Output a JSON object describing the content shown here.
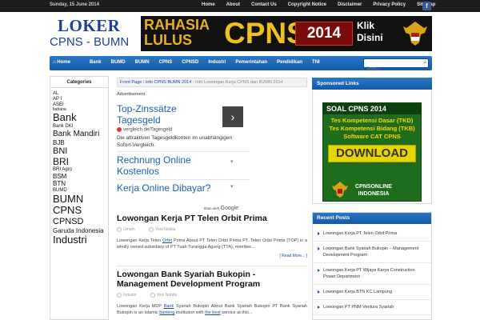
{
  "topbar": {
    "date": "Sunday, 15 June 2014",
    "links": [
      "Home",
      "About",
      "Contact Us",
      "Copyright Notice",
      "Disclaimer",
      "Privacy Policy",
      "Sitemap"
    ],
    "social_icon": "facebook-icon"
  },
  "logo": {
    "line1": "LOKER",
    "line2": "CPNS - BUMN"
  },
  "banner": {
    "line1": "RAHASIA",
    "line2": "LULUS",
    "big": "CPNS",
    "year": "2014",
    "cta_line1": "Klik",
    "cta_line2": "Disini",
    "emblem": "garuda-emblem"
  },
  "nav": {
    "items": [
      "Home",
      "Bank",
      "BUMD",
      "BUMN",
      "CPNS",
      "CPNSD",
      "Industri",
      "Pemerintahan",
      "Pendidikan",
      "TNI"
    ],
    "search_placeholder": "Search..."
  },
  "categories": {
    "title": "Categories",
    "items": [
      {
        "label": "AL",
        "size": 6
      },
      {
        "label": "AP I",
        "size": 6
      },
      {
        "label": "ASEI",
        "size": 6
      },
      {
        "label": "bahana",
        "size": 5
      },
      {
        "label": "Bank",
        "size": 13
      },
      {
        "label": "Bank DKI",
        "size": 6
      },
      {
        "label": "Bank Mandiri",
        "size": 10
      },
      {
        "label": "BJB",
        "size": 8
      },
      {
        "label": "BNI",
        "size": 11
      },
      {
        "label": "BRI",
        "size": 12
      },
      {
        "label": "BRI Agro",
        "size": 6
      },
      {
        "label": "BSM",
        "size": 8
      },
      {
        "label": "BTN",
        "size": 8
      },
      {
        "label": "BUMD",
        "size": 6
      },
      {
        "label": "BUMN",
        "size": 13
      },
      {
        "label": "CPNS",
        "size": 13
      },
      {
        "label": "CPNSD",
        "size": 11
      },
      {
        "label": "Garuda Indonesia",
        "size": 8
      },
      {
        "label": "Industri",
        "size": 13
      }
    ]
  },
  "breadcrumb": {
    "home": "Front Page",
    "sep1": " / ",
    "category": "Info CPNS BUMN 2014",
    "sep2": " - ",
    "current": "Info Lowongan Kerja CPNS dan BUMN 2014"
  },
  "advert": {
    "label": "Advertisement",
    "title": "Top-Zinssätze Tagesgeld",
    "url": "vergleich.de/Tagesgeld",
    "description": "Die attraktiven Tagesgeldkonten im unabhängigen Sofort-Vergleich.",
    "links": [
      "Rechnung Online Kostenlos",
      "Kerja Online Dibayar?"
    ],
    "footer_text": "Iklan oleh",
    "footer_brand": "Google"
  },
  "posts": [
    {
      "title": "Lowongan Kerja PT Telen Orbit Prima",
      "category": "Umum",
      "author": "Yoni Nobita",
      "excerpt_parts": [
        "Lowongan Kerja Telen ",
        "Orbit",
        " Prima About PT Telen Orbit Prima PT. Telen Orbit Prima (TOP) is a wholly owned subsidiary of PT Tuah Turangga Agung (TTA), member..."
      ],
      "more": "[ Read More... ]"
    },
    {
      "title": "Lowongan Bank Syariah Bukopin - Management Development Program",
      "category": "Industri",
      "author": "Yoni Nobita",
      "excerpt_parts": [
        "Lowongan Kerja MDP ",
        "Bank",
        " Syariah Bukopin About Bank Syariah Bukopin PT Bank Syariah Bukopin is an Islamic ",
        "banking",
        " institution with ",
        "the best",
        " service at this..."
      ]
    }
  ],
  "sponsored": {
    "title": "Sponsored Links",
    "ad_line1": "SOAL CPNS 2014",
    "ad_line2": "Tes Kompetensi Dasar (TKD)",
    "ad_line3": "Tes Kompetensi Bidang (TKB)",
    "ad_line4": "Software CAT CPNS",
    "ad_button": "DOWNLOAD",
    "ad_brand1": "CPNSONLINE",
    "ad_brand2": "INDONESIA"
  },
  "recent": {
    "title": "Recent Posts",
    "items": [
      "Lowongan Kerja PT Telen Orbit Prima",
      "Lowongan Bank Syariah Bukopin – Management Development Program",
      "Lowongan Kerja PT Wijaya Karya Construction Power Department",
      "Lowongan Kerja BTN KC Lampung",
      "Lowongan PT PNM Ventura Syariah"
    ]
  }
}
